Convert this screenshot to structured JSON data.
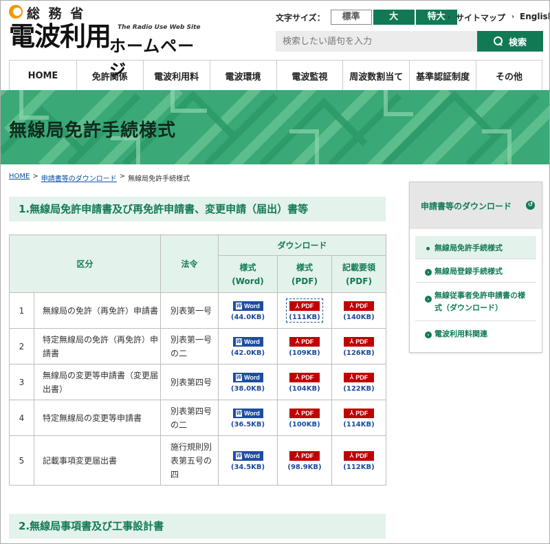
{
  "header": {
    "ministry": "総 務 省",
    "site_title": "電波利用",
    "site_title_en": "The Radio Use Web Site",
    "site_title_sub": "ホームページ",
    "font_size_label": "文字サイズ：",
    "font_sizes": [
      "標準",
      "大",
      "特大"
    ],
    "links": {
      "sitemap": "サイトマップ",
      "english": "English"
    },
    "search_placeholder": "検索したい語句を入力",
    "search_button": "検索"
  },
  "nav": [
    "HOME",
    "免許関係",
    "電波利用料",
    "電波環境",
    "電波監視",
    "周波数割当て",
    "基準認証制度",
    "その他"
  ],
  "page_title": "無線局免許手続様式",
  "breadcrumb": [
    "HOME",
    "申請書等のダウンロード",
    "無線局免許手続様式"
  ],
  "section1": "1.無線局免許申請書及び再免許申請書、変更申請（届出）書等",
  "section2": "2.無線局事項書及び工事設計書",
  "table": {
    "headers": {
      "category": "区分",
      "law": "法令",
      "download": "ダウンロード",
      "word": "様式\n(Word)",
      "word_l1": "様式",
      "word_l2": "(Word)",
      "pdf_l1": "様式",
      "pdf_l2": "(PDF)",
      "guide_l1": "記載要領",
      "guide_l2": "(PDF)"
    },
    "badge_word": "Word",
    "badge_pdf": "PDF",
    "rows": [
      {
        "no": "1",
        "name": "無線局の免許（再免許）申請書",
        "law": "別表第一号",
        "word": "(44.0KB)",
        "pdf": "(111KB)",
        "guide": "(140KB)"
      },
      {
        "no": "2",
        "name": "特定無線局の免許（再免許）申請書",
        "law": "別表第一号の二",
        "word": "(42.0KB)",
        "pdf": "(109KB)",
        "guide": "(126KB)"
      },
      {
        "no": "3",
        "name": "無線局の変更等申請書（変更届出書）",
        "law": "別表第四号",
        "word": "(38.0KB)",
        "pdf": "(104KB)",
        "guide": "(122KB)"
      },
      {
        "no": "4",
        "name": "特定無線局の変更等申請書",
        "law": "別表第四号の二",
        "word": "(36.5KB)",
        "pdf": "(100KB)",
        "guide": "(114KB)"
      },
      {
        "no": "5",
        "name": "記載事項変更届出書",
        "law": "施行規則別表第五号の四",
        "word": "(34.5KB)",
        "pdf": "(98.9KB)",
        "guide": "(112KB)"
      }
    ]
  },
  "sidebar": {
    "title": "申請書等のダウンロード",
    "items": [
      "無線局免許手続様式",
      "無線局登録手続様式",
      "無線従事者免許申請書の様式（ダウンロード）",
      "電波利用料関連"
    ]
  },
  "colors": {
    "brand_green": "#117a55",
    "light_green": "#e3f2ea",
    "word_blue": "#1e4ca0",
    "pdf_red": "#c00000",
    "logo_orange": "#f39800"
  }
}
